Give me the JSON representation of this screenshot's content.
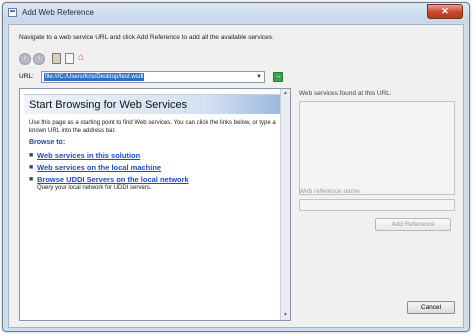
{
  "window": {
    "title": "Add Web Reference",
    "close_glyph": "✕"
  },
  "instruction": "Navigate to a web service URL and click Add Reference to add all the available services.",
  "toolbar": {
    "back_glyph": "‹",
    "forward_glyph": "›",
    "icons": [
      "back-icon",
      "forward-icon",
      "stop-icon",
      "refresh-icon",
      "home-icon"
    ]
  },
  "url": {
    "label": "URL:",
    "value": "file:///C:/Users/Kris/Desktop/test.wsdl",
    "dropdown_glyph": "▼",
    "go_glyph": "→"
  },
  "browser": {
    "title": "Start Browsing for Web Services",
    "intro": "Use this page as a starting point to find Web services. You can click the links below, or type a known URL into the address bar.",
    "browse_to": "Browse to:",
    "bullet_glyph": "■",
    "links": [
      {
        "label": "Web services in this solution",
        "description": ""
      },
      {
        "label": "Web services on the local machine",
        "description": ""
      },
      {
        "label": "Browse UDDI Servers on the local network",
        "description": "Query your local network for UDDI servers."
      }
    ]
  },
  "services": {
    "label": "Web services found at this URL:"
  },
  "reference": {
    "label": "Web reference name:",
    "value": ""
  },
  "buttons": {
    "add_reference": "Add Reference",
    "cancel": "Cancel"
  },
  "colors": {
    "link": "#1e4cc0",
    "selection": "#3170c6",
    "close_button": "#c8462d"
  }
}
